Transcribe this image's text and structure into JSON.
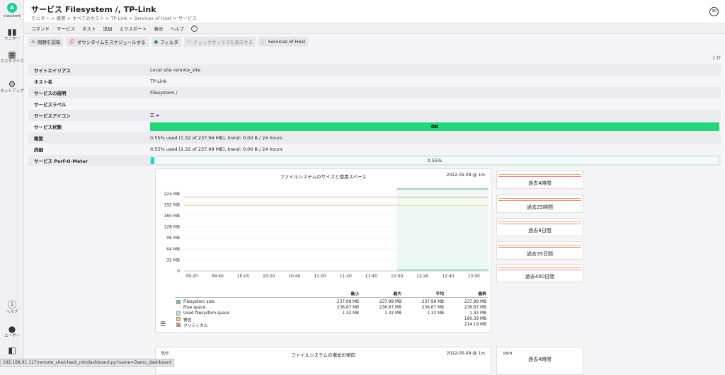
{
  "sidebar": {
    "logo_text": "checkmk",
    "items": [
      {
        "icon": "bar-chart-icon",
        "glyph": "▮▮",
        "label": "モニター"
      },
      {
        "icon": "grid-icon",
        "glyph": "▦",
        "label": "カスタマイズ"
      },
      {
        "icon": "gear-icon",
        "glyph": "⚙",
        "label": "セットアップ"
      }
    ],
    "bottom": [
      {
        "icon": "help-icon",
        "glyph": "ⓘ",
        "label": "ヘルプ"
      },
      {
        "icon": "user-icon",
        "glyph": "●",
        "label": "ユーザー"
      },
      {
        "icon": "sidebar-toggle-icon",
        "glyph": "◧",
        "label": ""
      }
    ]
  },
  "header": {
    "title": "サービス Filesystem /, TP-Link",
    "breadcrumb": "モニター > 概要 > すべてのホスト > TP-Link > Services of Host > サービス",
    "refresh": "30"
  },
  "menu": [
    "コマンド",
    "サービス",
    "ホスト",
    "追加",
    "エクスポート",
    "表示",
    "ヘルプ"
  ],
  "toolbar": [
    {
      "label": "問題を認知",
      "icon": "warning-icon",
      "glyph": "⚠",
      "color": "#333"
    },
    {
      "label": "ダウンタイムをスケジュールする",
      "icon": "downtime-icon",
      "glyph": "⛑",
      "color": "#d33"
    },
    {
      "label": "フィルタ",
      "icon": "filter-icon",
      "glyph": "●",
      "color": "#1a9f4a"
    },
    {
      "label": "チェックボックスを表示する",
      "icon": "checkbox-icon",
      "glyph": "☐",
      "color": "#888"
    },
    {
      "label": "Services of Host",
      "icon": "services-icon",
      "glyph": "ⓘ",
      "color": "#555"
    }
  ],
  "row_count": "1 行",
  "details": [
    {
      "label": "サイトエイリアス",
      "value": "Local site remote_site"
    },
    {
      "label": "ホスト名",
      "value": "TP-Link"
    },
    {
      "label": "サービスの説明",
      "value": "Filesystem /"
    },
    {
      "label": "サービスラベル",
      "value": ""
    },
    {
      "label": "サービスアイコン",
      "value": "☰"
    },
    {
      "label": "サービス状態",
      "value": "OK"
    },
    {
      "label": "概要",
      "value": "0.55% used (1.32 of 237.99 MB), trend: 0.00 B / 24 hours"
    },
    {
      "label": "詳細",
      "value": "0.55% used (1.32 of 237.99 MB), trend: 0.00 B / 24 hours"
    },
    {
      "label": "サービス Perf-O-Meter",
      "value": "0.55%"
    }
  ],
  "perf_fill": 0.0055,
  "graph": {
    "title": "ファイルシステムのサイズと使用スペース",
    "date": "2022-05-09 @ 1m",
    "legend_headers": [
      "最小",
      "最大",
      "平均",
      "最終"
    ],
    "legend": [
      {
        "name": "Filesystem size",
        "color": "#7fb8aa",
        "vals": [
          "237.99 MB",
          "237.99 MB",
          "237.99 MB",
          "237.99 MB"
        ]
      },
      {
        "name": "Free space",
        "color": "",
        "vals": [
          "236.67 MB",
          "236.67 MB",
          "236.67 MB",
          "236.67 MB"
        ]
      },
      {
        "name": "Used filesystem space",
        "color": "#9fe8e4",
        "vals": [
          "1.32 MB",
          "1.32 MB",
          "1.32 MB",
          "1.32 MB"
        ]
      },
      {
        "name": "警告",
        "color": "#f5cf60",
        "vals": [
          "",
          "",
          "",
          "190.39 MB"
        ]
      },
      {
        "name": "クリティカル",
        "color": "#f08080",
        "vals": [
          "",
          "",
          "",
          "214.19 MB"
        ]
      }
    ]
  },
  "chart_data": {
    "type": "line",
    "title": "ファイルシステムのサイズと使用スペース",
    "x": [
      "09:20",
      "09:40",
      "10:00",
      "10:20",
      "10:40",
      "11:00",
      "11:20",
      "11:40",
      "12:00",
      "12:20",
      "12:40",
      "13:00"
    ],
    "yticks": [
      "224 MB",
      "192 MB",
      "160 MB",
      "128 MB",
      "96 MB",
      "64 MB",
      "32 MB",
      "0"
    ],
    "ylim": [
      0,
      240
    ],
    "series": [
      {
        "name": "Filesystem size",
        "values": [
          237.99
        ],
        "start": "12:00"
      },
      {
        "name": "Used filesystem space",
        "values": [
          1.32
        ],
        "start": "12:00"
      },
      {
        "name": "警告",
        "values": [
          190.39
        ]
      },
      {
        "name": "クリティカル",
        "values": [
          214.19
        ]
      }
    ]
  },
  "minis": [
    "過去4時間",
    "過去25時間",
    "過去8日間",
    "過去35日間",
    "過去400日間"
  ],
  "graph2": {
    "title": "ファイルシステムの増加の傾向",
    "date": "2022-05-09 @ 1m",
    "unit": "B/d",
    "mini_unit": "kB/d",
    "mini": "過去4時間"
  },
  "status_url": "192.168.91.117/remote_site/check_mk/dashboard.py?name=Demo_dashboard"
}
